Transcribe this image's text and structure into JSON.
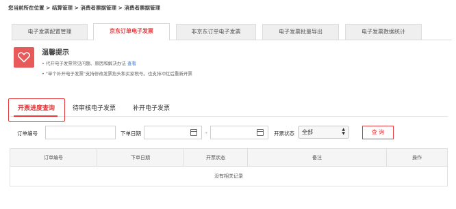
{
  "breadcrumb": "您当前所在位置 > 结算管理 > 消费者票据管理 > 消费者票据管理",
  "top_tabs": [
    {
      "label": "电子发票配置管理"
    },
    {
      "label": "京东订单电子发票"
    },
    {
      "label": "非京东订单电子发票"
    },
    {
      "label": "电子发票批量导出"
    },
    {
      "label": "电子发票数据统计"
    }
  ],
  "tips": {
    "title": "温馨提示",
    "line1": "• 代开电子发票常见问题、原因和解决办法",
    "line1_link": "查看",
    "line2": "• \"单个补开电子发票\"支持修改发票抬头和买家税号。也支持冲红后重新开票"
  },
  "sub_tabs": [
    {
      "label": "开票进度查询"
    },
    {
      "label": "待审核电子发票"
    },
    {
      "label": "补开电子发票"
    }
  ],
  "filters": {
    "order_no_label": "订单编号",
    "order_date_label": "下单日期",
    "date_separator": "-",
    "status_label": "开票状态",
    "status_value": "全部",
    "query_button": "查 询"
  },
  "table": {
    "headers": [
      "订单编号",
      "下单日期",
      "开票状态",
      "备注",
      "操作"
    ],
    "empty_text": "没有相关记录"
  }
}
